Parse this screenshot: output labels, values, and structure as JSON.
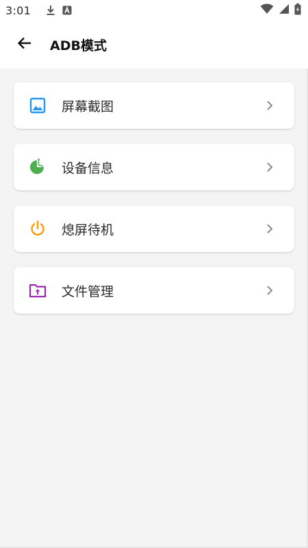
{
  "status_bar": {
    "time": "3:01",
    "icons": [
      "download-icon",
      "a-app-icon",
      "wifi-icon",
      "signal-icon",
      "battery-icon"
    ]
  },
  "app_bar": {
    "title": "ADB模式",
    "back_icon": "back-arrow-icon"
  },
  "menu": {
    "items": [
      {
        "label": "屏幕截图",
        "icon": "image-icon",
        "color": "#2196f3"
      },
      {
        "label": "设备信息",
        "icon": "pie-chart-icon",
        "color": "#4caf50"
      },
      {
        "label": "熄屏待机",
        "icon": "power-icon",
        "color": "#ff9800"
      },
      {
        "label": "文件管理",
        "icon": "folder-upload-icon",
        "color": "#9c27b0"
      }
    ]
  },
  "colors": {
    "background": "#f4f4f4",
    "card": "#ffffff",
    "chevron": "#8a8a8a"
  }
}
